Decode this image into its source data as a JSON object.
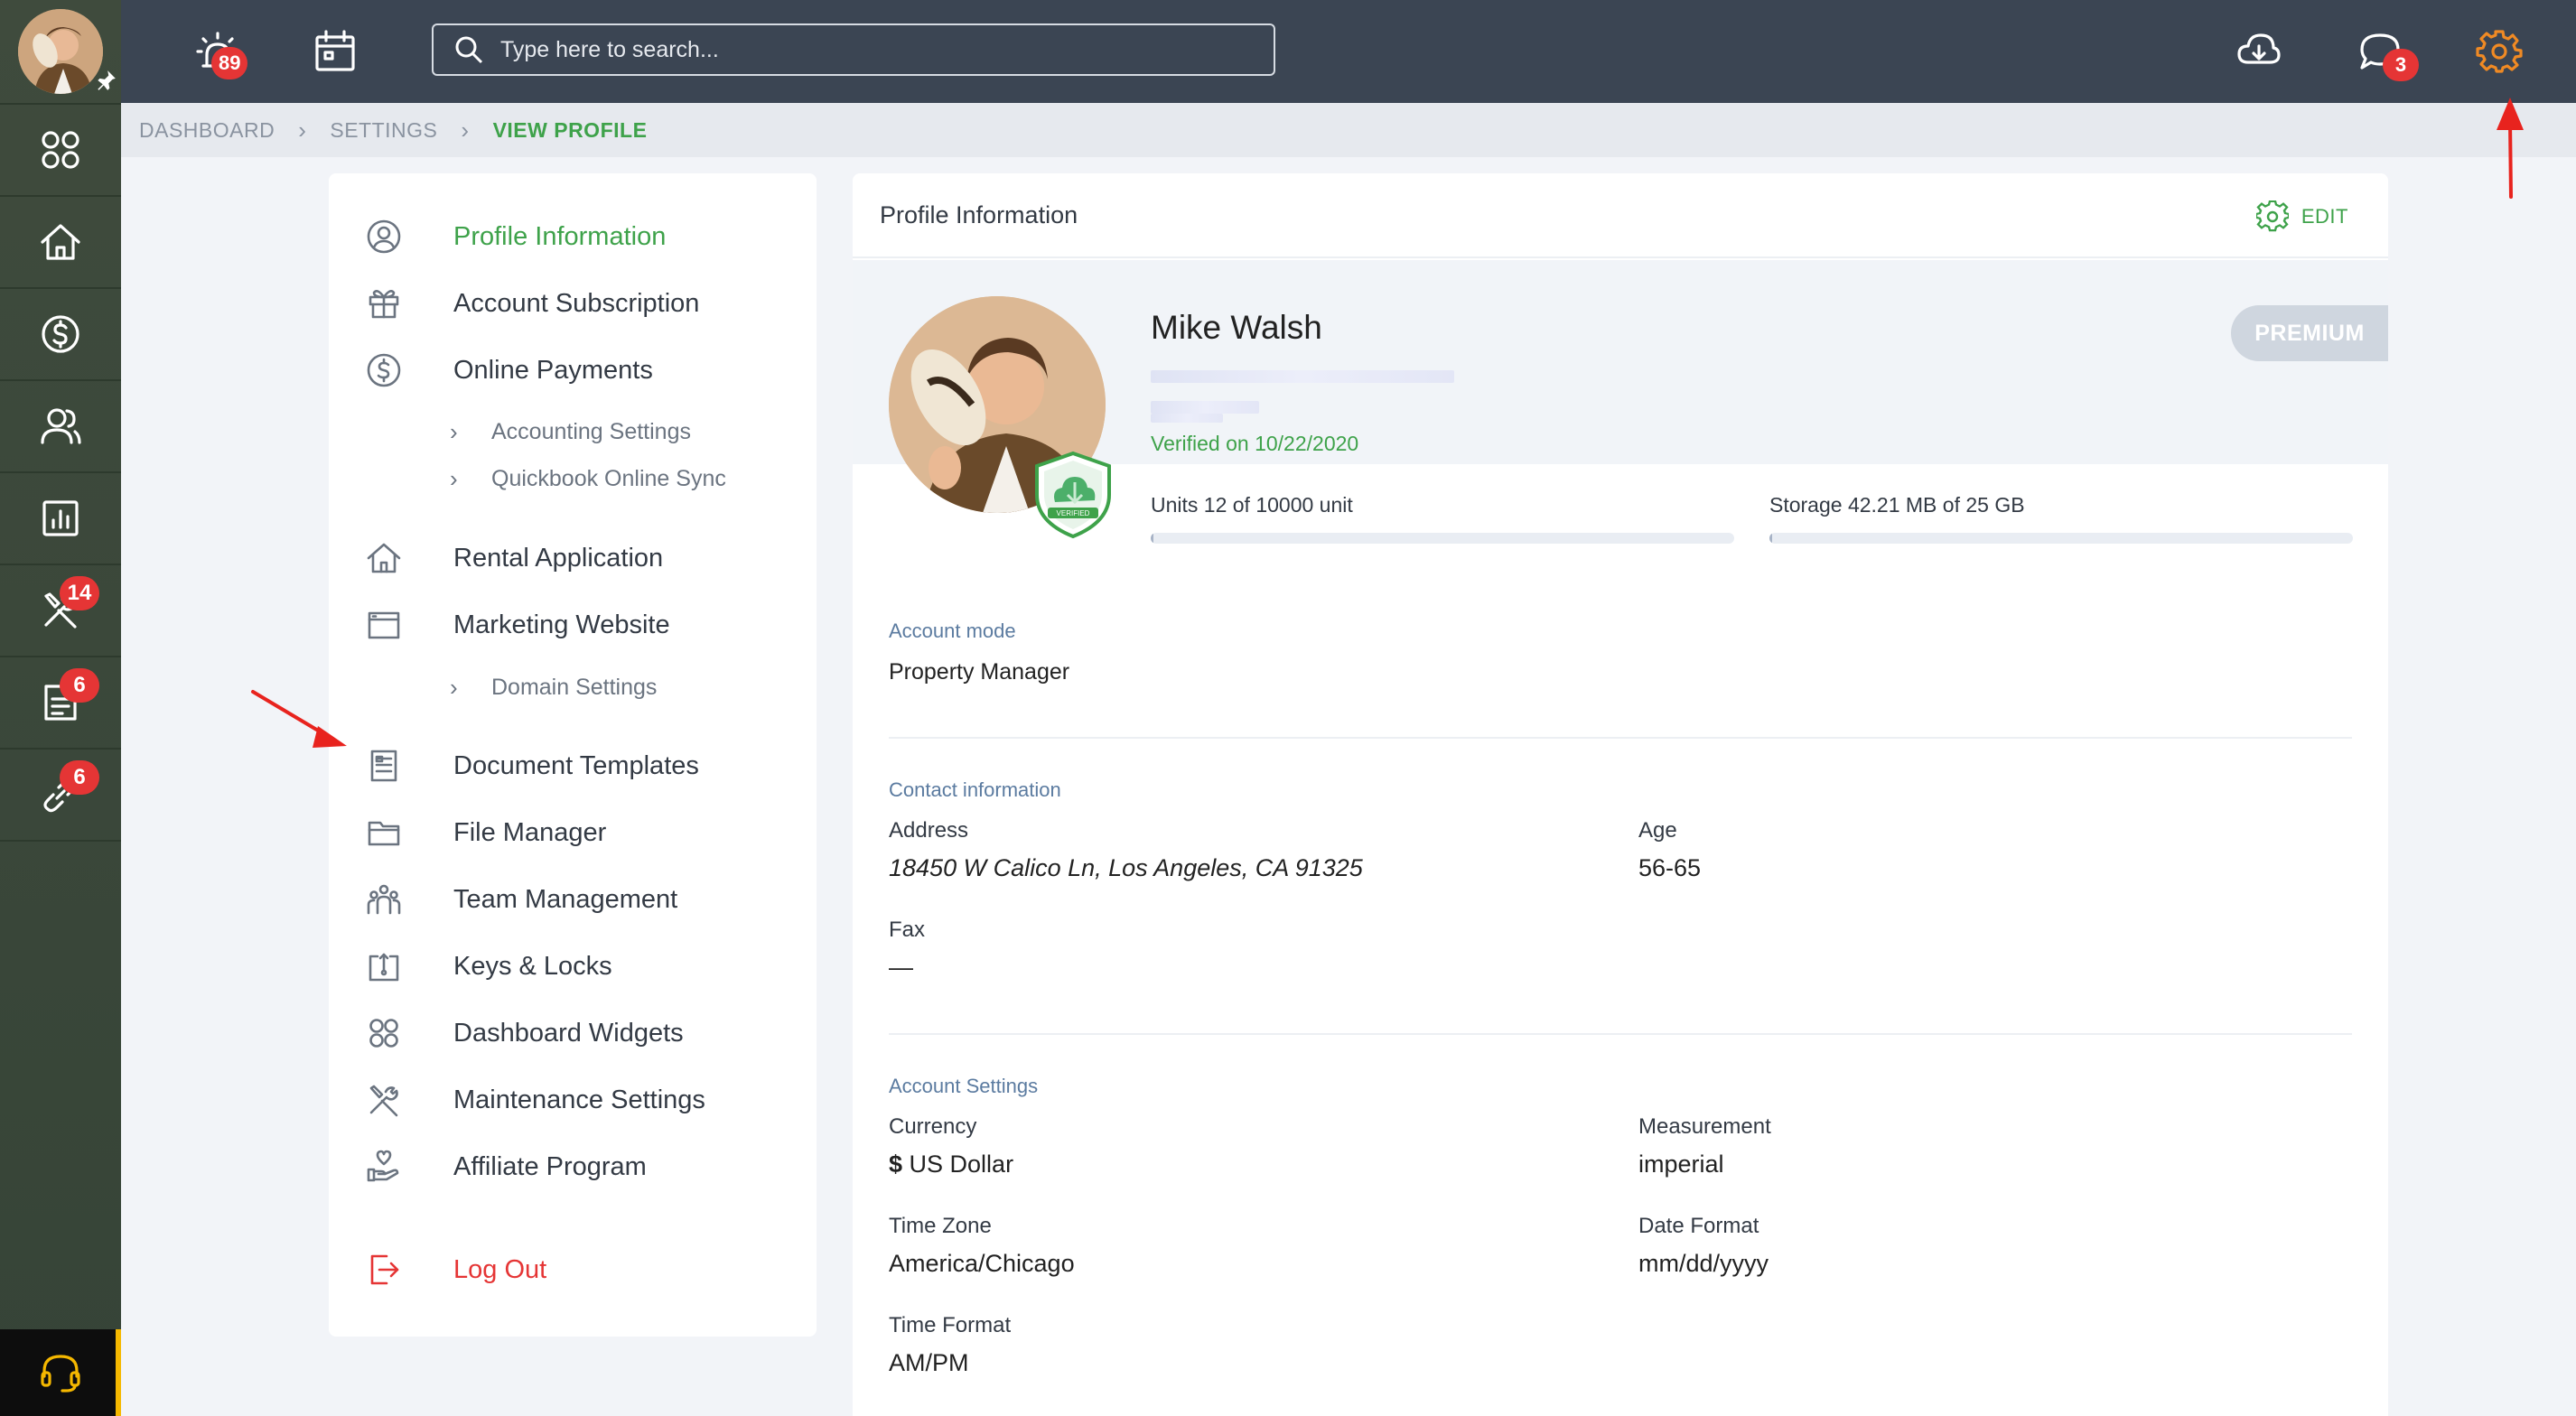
{
  "rail": {
    "items": [
      {
        "name": "dashboard",
        "icon": "grid-icon"
      },
      {
        "name": "home",
        "icon": "home-icon"
      },
      {
        "name": "payments",
        "icon": "dollar-icon"
      },
      {
        "name": "people",
        "icon": "users-icon"
      },
      {
        "name": "reports",
        "icon": "bar-chart-icon"
      },
      {
        "name": "maintenance",
        "icon": "tools-icon",
        "badge": "14"
      },
      {
        "name": "documents",
        "icon": "document-icon",
        "badge": "6"
      },
      {
        "name": "links",
        "icon": "link-icon",
        "badge": "6"
      }
    ],
    "support_icon": "headset-icon"
  },
  "topbar": {
    "alarm_badge": "89",
    "search_placeholder": "Type here to search...",
    "messages_badge": "3"
  },
  "breadcrumb": {
    "items": [
      "DASHBOARD",
      "SETTINGS",
      "VIEW PROFILE"
    ]
  },
  "menu": {
    "items": [
      {
        "label": "Profile Information",
        "icon": "user-circle-icon",
        "active": true
      },
      {
        "label": "Account Subscription",
        "icon": "gift-icon"
      },
      {
        "label": "Online Payments",
        "icon": "dollar-circle-icon"
      },
      {
        "label": "Rental Application",
        "icon": "home-icon"
      },
      {
        "label": "Marketing Website",
        "icon": "browser-icon"
      },
      {
        "label": "Document Templates",
        "icon": "document-icon"
      },
      {
        "label": "File Manager",
        "icon": "folder-icon"
      },
      {
        "label": "Team Management",
        "icon": "team-icon"
      },
      {
        "label": "Keys & Locks",
        "icon": "key-box-icon"
      },
      {
        "label": "Dashboard Widgets",
        "icon": "grid-icon"
      },
      {
        "label": "Maintenance Settings",
        "icon": "tools-icon"
      },
      {
        "label": "Affiliate Program",
        "icon": "hand-heart-icon"
      }
    ],
    "subitems": {
      "accounting": "Accounting Settings",
      "quickbook": "Quickbook Online Sync",
      "domain": "Domain Settings"
    },
    "logout": "Log Out"
  },
  "profile": {
    "header_title": "Profile Information",
    "edit_label": "EDIT",
    "name": "Mike Walsh",
    "verified_on": "Verified on 10/22/2020",
    "badge_text": "VERIFIED",
    "plan": "PREMIUM",
    "units": {
      "label": "Units 12 of 10000 unit",
      "fraction": 0.0012
    },
    "storage": {
      "label": "Storage 42.21 MB of 25 GB",
      "fraction": 0.0017
    },
    "account_mode": {
      "section": "Account mode",
      "value": "Property Manager"
    },
    "contact": {
      "section": "Contact information",
      "address_label": "Address",
      "address": "18450 W Calico Ln, Los Angeles, CA 91325",
      "age_label": "Age",
      "age": "56-65",
      "fax_label": "Fax",
      "fax": "—"
    },
    "settings": {
      "section": "Account Settings",
      "currency_label": "Currency",
      "currency_symbol": "$",
      "currency": " US Dollar",
      "measurement_label": "Measurement",
      "measurement": "imperial",
      "timezone_label": "Time Zone",
      "timezone": "America/Chicago",
      "date_format_label": "Date Format",
      "date_format": "mm/dd/yyyy",
      "time_format_label": "Time Format",
      "time_format": "AM/PM"
    }
  },
  "colors": {
    "accent_green": "#3ea24a",
    "badge_red": "#e53535",
    "topbar": "#3b4553",
    "rail": "#3c4a3c",
    "settings_icon": "#f08a24",
    "support_yellow": "#f5b800"
  }
}
